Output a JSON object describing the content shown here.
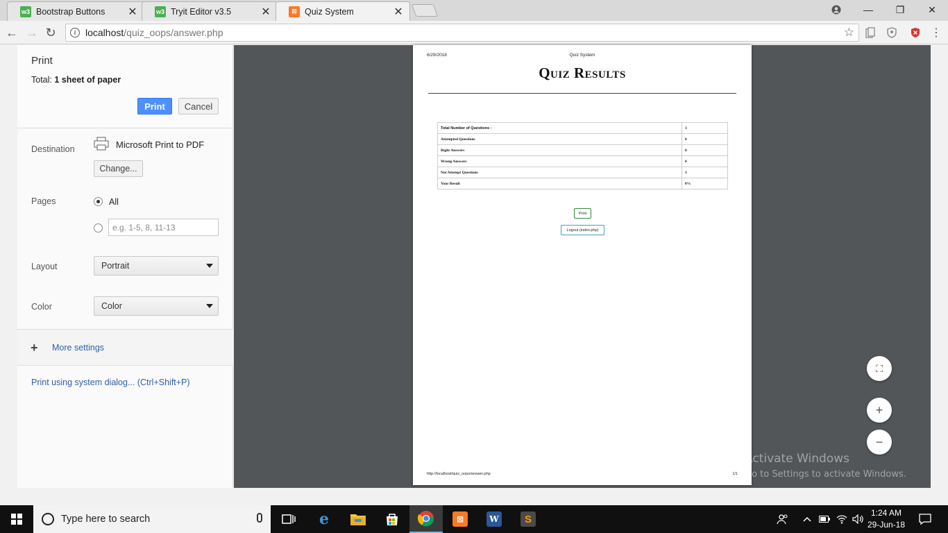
{
  "browser": {
    "tabs": [
      {
        "label": "Bootstrap Buttons",
        "favicon": "w3"
      },
      {
        "label": "Tryit Editor v3.5",
        "favicon": "w3"
      },
      {
        "label": "Quiz System",
        "favicon": "xampp",
        "active": true
      }
    ],
    "favicon_w3": "w3",
    "favicon_xampp": "⊠",
    "tab_close": "✕",
    "window_controls": {
      "minimize": "—",
      "maximize": "❐",
      "close": "✕"
    },
    "url_host": "localhost",
    "url_path": "/quiz_oops/answer.php",
    "nav": {
      "back": "←",
      "forward": "→",
      "reload": "↻"
    },
    "star": "☆"
  },
  "print_panel": {
    "title": "Print",
    "total_label": "Total:",
    "total_value": "1 sheet of paper",
    "print_button": "Print",
    "cancel_button": "Cancel",
    "destination_label": "Destination",
    "destination_value": "Microsoft Print to PDF",
    "change_button": "Change...",
    "pages_label": "Pages",
    "pages_all": "All",
    "pages_placeholder": "e.g. 1-5, 8, 11-13",
    "layout_label": "Layout",
    "layout_value": "Portrait",
    "color_label": "Color",
    "color_value": "Color",
    "more_settings": "More settings",
    "more_settings_plus": "+",
    "system_dialog": "Print using system dialog... (Ctrl+Shift+P)"
  },
  "preview_page": {
    "date": "6/29/2018",
    "header_title": "Quiz System",
    "heading": "Quiz Results",
    "results": [
      {
        "label": "Total Number of Questions :",
        "value": "3"
      },
      {
        "label": "Attempted Questions",
        "value": "0"
      },
      {
        "label": "Right Answers",
        "value": "0"
      },
      {
        "label": "Wrong Answers",
        "value": "0"
      },
      {
        "label": "Not Attempt Questions",
        "value": "3"
      },
      {
        "label": "Your Result",
        "value": "0%"
      }
    ],
    "print_button": "Print",
    "logout_button": "Logout (index.php)",
    "footer_url": "http://localhost/quiz_oops/answer.php",
    "page_number": "1/1"
  },
  "zoom": {
    "fit": "⛶",
    "zoom_in": "+",
    "zoom_out": "−"
  },
  "watermark": {
    "line1": "Activate Windows",
    "line2": "Go to Settings to activate Windows."
  },
  "taskbar": {
    "search_placeholder": "Type here to search",
    "time": "1:24 AM",
    "date": "29-Jun-18",
    "word_glyph": "W",
    "sublime_glyph": "S"
  },
  "colors": {
    "accent_blue": "#4d90fe",
    "preview_bg": "#525659",
    "taskbar_bg": "#101010",
    "link_blue": "#2f5ea8"
  }
}
